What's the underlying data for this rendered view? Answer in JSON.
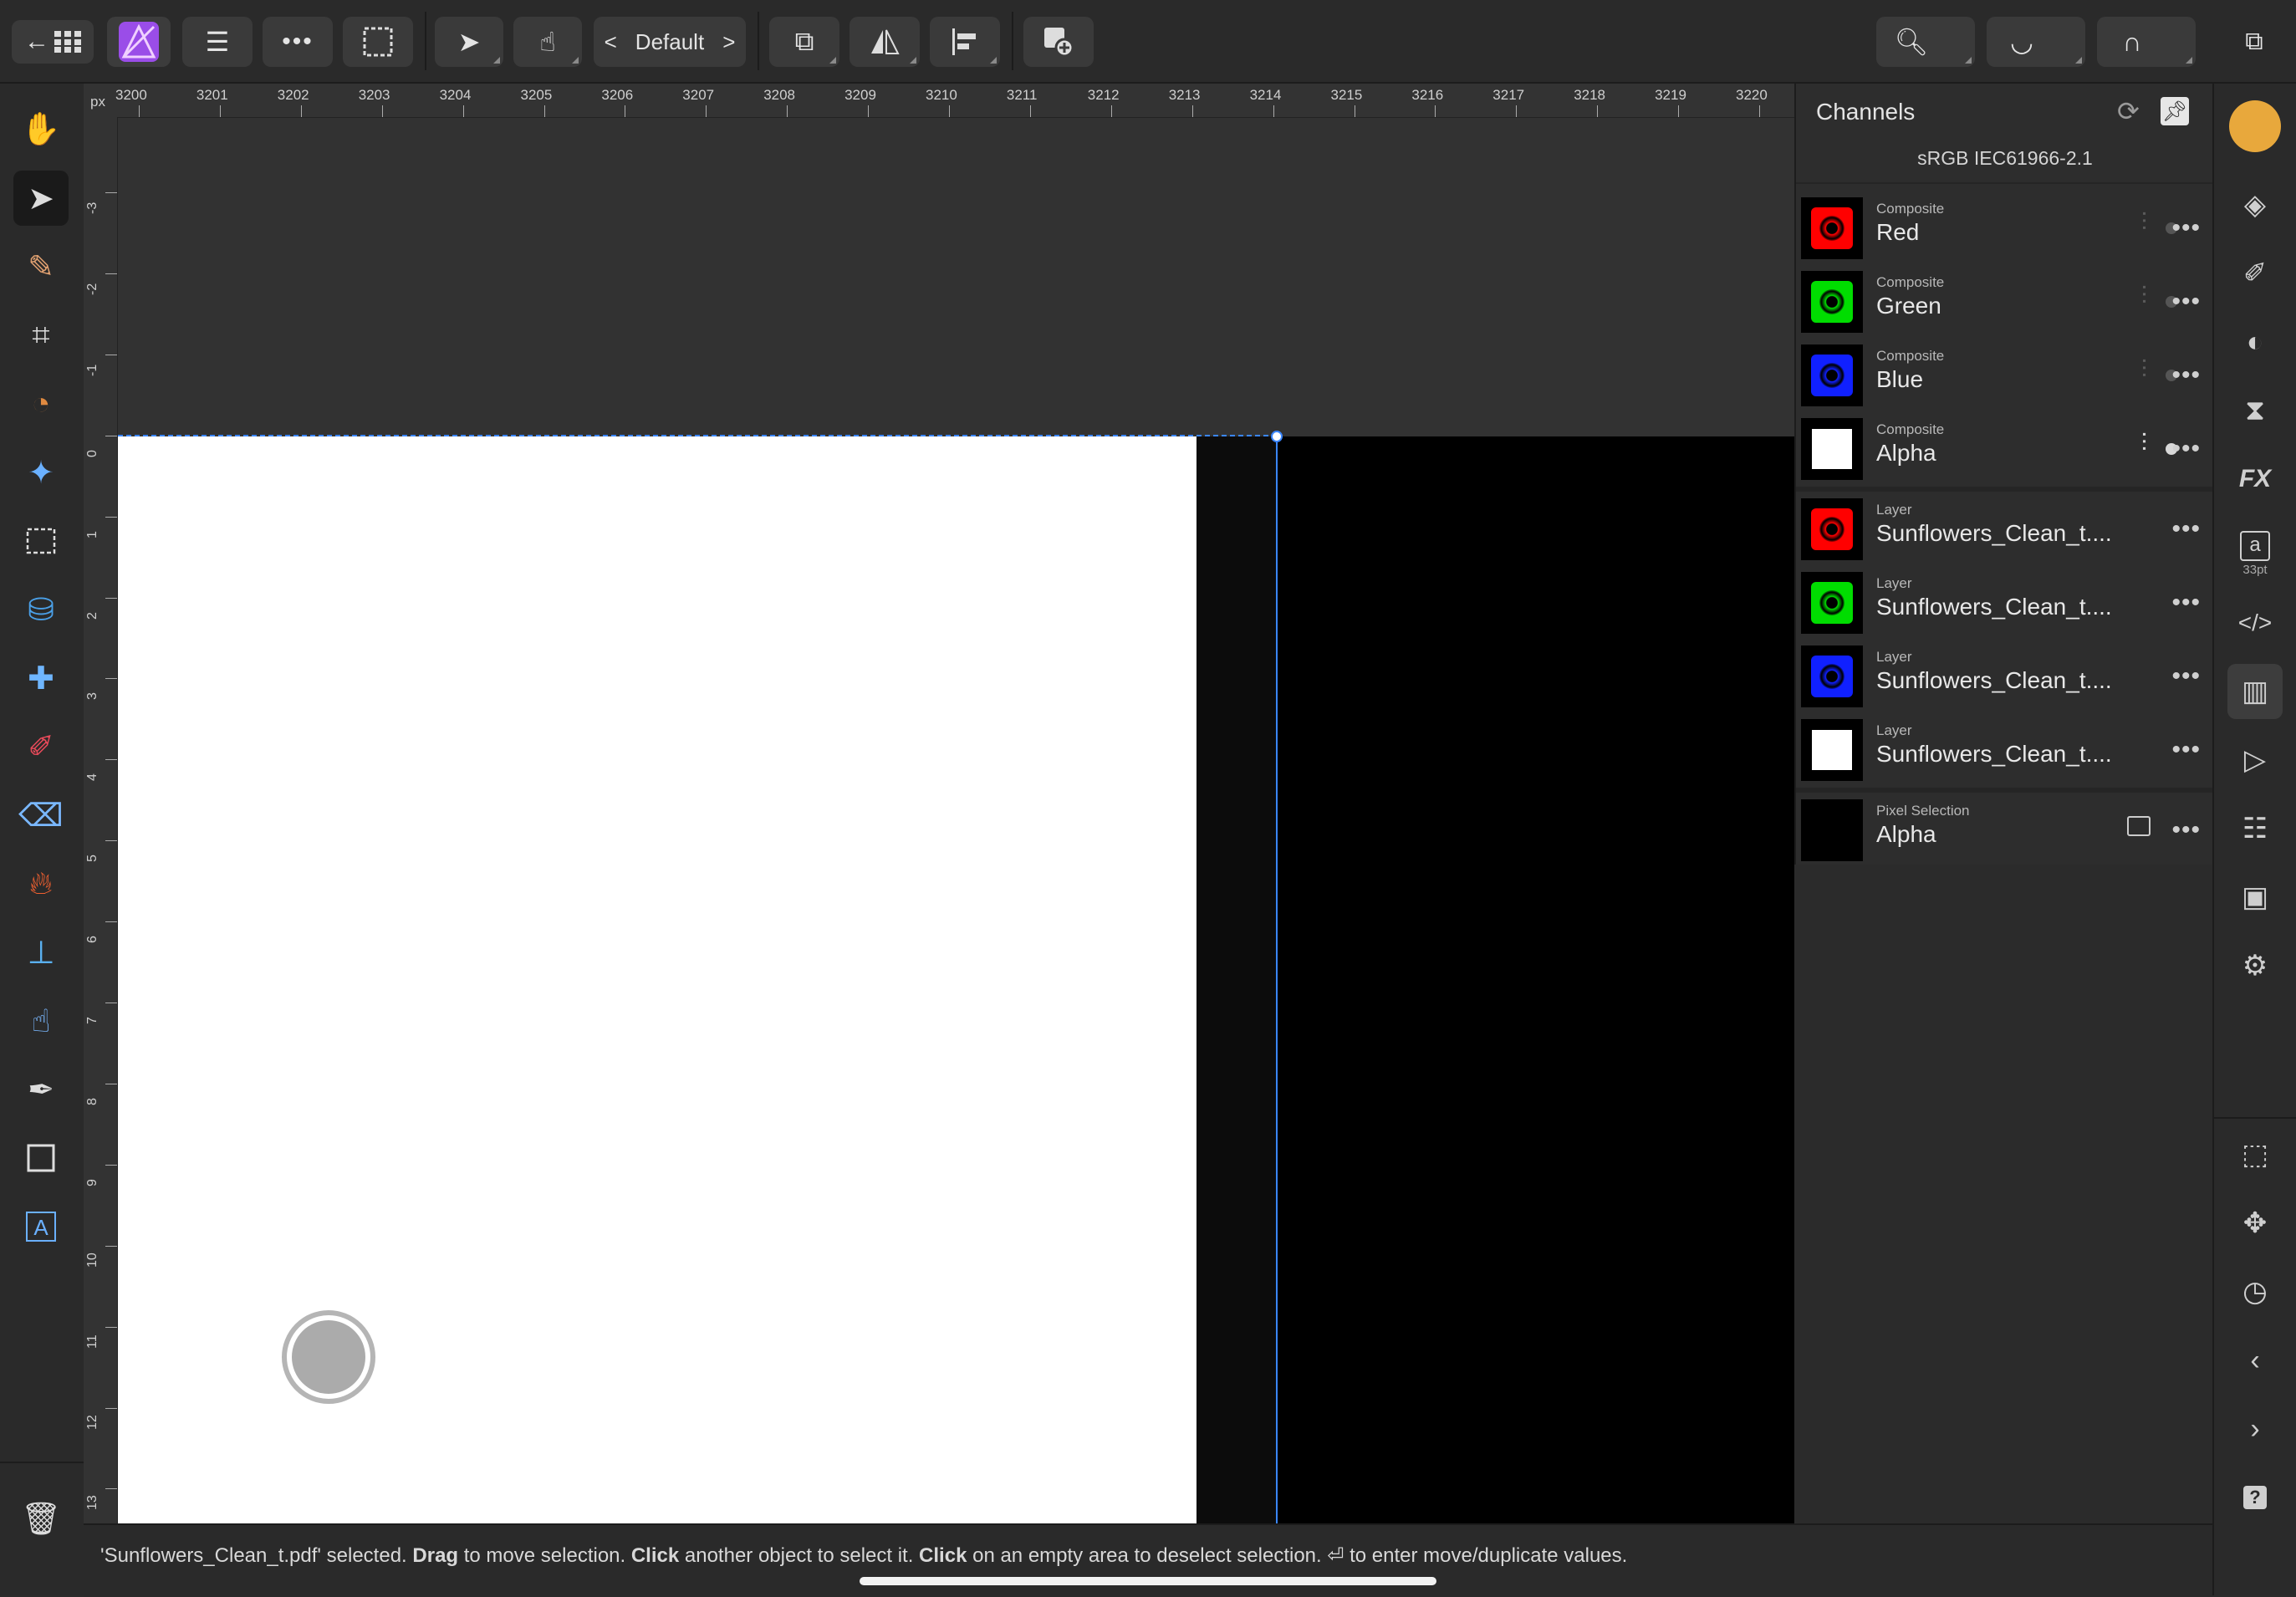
{
  "toolbar": {
    "preset": "Default",
    "prev": "<",
    "next": ">"
  },
  "ruler": {
    "unit": "px",
    "h_ticks": [
      "3200",
      "3201",
      "3202",
      "3203",
      "3204",
      "3205",
      "3206",
      "3207",
      "3208",
      "3209",
      "3210",
      "3211",
      "3212",
      "3213",
      "3214",
      "3215",
      "3216",
      "3217",
      "3218",
      "3219",
      "3220"
    ],
    "v_ticks": [
      "-3",
      "-2",
      "-1",
      "0",
      "1",
      "2",
      "3",
      "4",
      "5",
      "6",
      "7",
      "8",
      "9",
      "10",
      "11",
      "12",
      "13"
    ]
  },
  "panel": {
    "title": "Channels",
    "profile": "sRGB IEC61966-2.1",
    "rows": [
      {
        "kind": "Composite",
        "name": "Red",
        "color": "#ff0000"
      },
      {
        "kind": "Composite",
        "name": "Green",
        "color": "#00dd00"
      },
      {
        "kind": "Composite",
        "name": "Blue",
        "color": "#1020ff"
      },
      {
        "kind": "Composite",
        "name": "Alpha",
        "color": "#ffffff"
      },
      {
        "kind": "Layer",
        "name": "Sunflowers_Clean_t....",
        "color": "#ff0000"
      },
      {
        "kind": "Layer",
        "name": "Sunflowers_Clean_t....",
        "color": "#00dd00"
      },
      {
        "kind": "Layer",
        "name": "Sunflowers_Clean_t....",
        "color": "#1020ff"
      },
      {
        "kind": "Layer",
        "name": "Sunflowers_Clean_t....",
        "color": "#ffffff"
      },
      {
        "kind": "Pixel Selection",
        "name": "Alpha",
        "color": "#000000"
      }
    ]
  },
  "right_sidebar": {
    "font_size_label": "33pt",
    "accent_color": "#e8a83c"
  },
  "status": {
    "s1": "'Sunflowers_Clean_t.pdf' selected. ",
    "b1": "Drag",
    "s2": " to move selection. ",
    "b2": "Click",
    "s3": " another object to select it. ",
    "b3": "Click",
    "s4": " on an empty area to deselect selection. ⏎ to enter move/duplicate values."
  },
  "colors": {
    "selection": "#3a86ff",
    "app_logo": "#a25cf0"
  }
}
